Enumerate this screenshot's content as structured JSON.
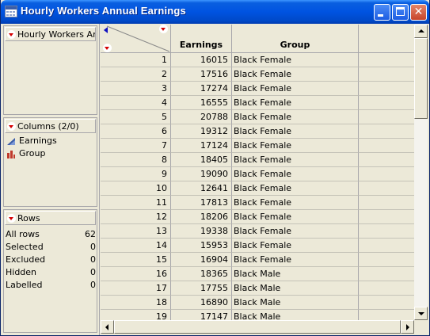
{
  "window": {
    "title": "Hourly Workers Annual Earnings",
    "buttons": [
      "minimize",
      "maximize",
      "close"
    ],
    "close_glyph": "✕"
  },
  "left": {
    "table_panel": {
      "label": "Hourly Workers Ann"
    },
    "columns_panel": {
      "label": "Columns (2/0)",
      "items": [
        {
          "label": "Earnings",
          "icon": "continuous-column-icon"
        },
        {
          "label": "Group",
          "icon": "nominal-column-icon"
        }
      ]
    },
    "rows_panel": {
      "label": "Rows",
      "stats": [
        {
          "label": "All rows",
          "value": "62"
        },
        {
          "label": "Selected",
          "value": "0"
        },
        {
          "label": "Excluded",
          "value": "0"
        },
        {
          "label": "Hidden",
          "value": "0"
        },
        {
          "label": "Labelled",
          "value": "0"
        }
      ]
    }
  },
  "table": {
    "columns": [
      "Earnings",
      "Group"
    ],
    "rows": [
      {
        "n": "1",
        "earnings": "16015",
        "group": "Black Female"
      },
      {
        "n": "2",
        "earnings": "17516",
        "group": "Black Female"
      },
      {
        "n": "3",
        "earnings": "17274",
        "group": "Black Female"
      },
      {
        "n": "4",
        "earnings": "16555",
        "group": "Black Female"
      },
      {
        "n": "5",
        "earnings": "20788",
        "group": "Black Female"
      },
      {
        "n": "6",
        "earnings": "19312",
        "group": "Black Female"
      },
      {
        "n": "7",
        "earnings": "17124",
        "group": "Black Female"
      },
      {
        "n": "8",
        "earnings": "18405",
        "group": "Black Female"
      },
      {
        "n": "9",
        "earnings": "19090",
        "group": "Black Female"
      },
      {
        "n": "10",
        "earnings": "12641",
        "group": "Black Female"
      },
      {
        "n": "11",
        "earnings": "17813",
        "group": "Black Female"
      },
      {
        "n": "12",
        "earnings": "18206",
        "group": "Black Female"
      },
      {
        "n": "13",
        "earnings": "19338",
        "group": "Black Female"
      },
      {
        "n": "14",
        "earnings": "15953",
        "group": "Black Female"
      },
      {
        "n": "15",
        "earnings": "16904",
        "group": "Black Female"
      },
      {
        "n": "16",
        "earnings": "18365",
        "group": "Black Male"
      },
      {
        "n": "17",
        "earnings": "17755",
        "group": "Black Male"
      },
      {
        "n": "18",
        "earnings": "16890",
        "group": "Black Male"
      },
      {
        "n": "19",
        "earnings": "17147",
        "group": "Black Male"
      }
    ]
  },
  "colors": {
    "accent_red": "#d40000",
    "titlebar_blue": "#0053e1",
    "panel_bg": "#ece9d8"
  }
}
